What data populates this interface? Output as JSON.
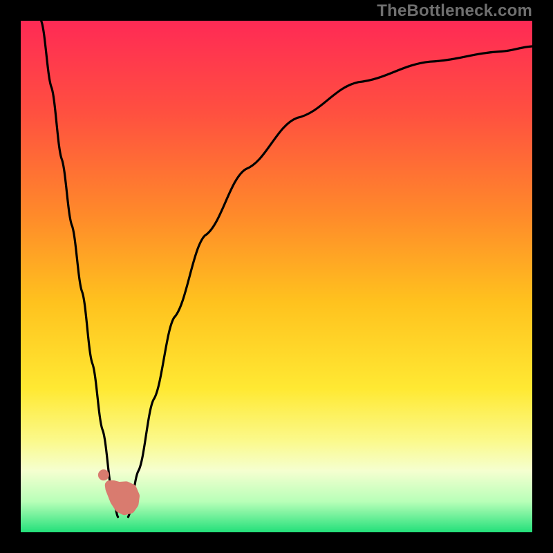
{
  "watermark": {
    "text": "TheBottleneck.com"
  },
  "colors": {
    "background_black": "#000000",
    "gradient_stops": [
      {
        "offset": 0.0,
        "color": "#ff2a55"
      },
      {
        "offset": 0.18,
        "color": "#ff5040"
      },
      {
        "offset": 0.38,
        "color": "#ff8a2a"
      },
      {
        "offset": 0.55,
        "color": "#ffc21e"
      },
      {
        "offset": 0.72,
        "color": "#ffe933"
      },
      {
        "offset": 0.82,
        "color": "#fbf98a"
      },
      {
        "offset": 0.88,
        "color": "#f5ffd0"
      },
      {
        "offset": 0.94,
        "color": "#b8ffb8"
      },
      {
        "offset": 1.0,
        "color": "#23e07a"
      }
    ],
    "curve_color": "#000000",
    "blob_color": "#d97b6f"
  },
  "chart_data": {
    "type": "line",
    "title": "",
    "xlabel": "",
    "ylabel": "",
    "xlim": [
      0,
      100
    ],
    "ylim": [
      0,
      100
    ],
    "series": [
      {
        "name": "left-curve",
        "x": [
          4,
          6,
          8,
          10,
          12,
          14,
          16,
          18,
          19
        ],
        "y": [
          100,
          87,
          73,
          60,
          47,
          33,
          20,
          7,
          3
        ]
      },
      {
        "name": "right-curve",
        "x": [
          21,
          23,
          26,
          30,
          36,
          44,
          54,
          66,
          80,
          94,
          100
        ],
        "y": [
          3,
          12,
          26,
          42,
          58,
          71,
          81,
          88,
          92,
          94,
          95
        ]
      }
    ],
    "blob": {
      "name": "highlight-region",
      "points_xy": [
        [
          17.5,
          8.5
        ],
        [
          18.4,
          6.2
        ],
        [
          19.3,
          4.8
        ],
        [
          20.3,
          4.3
        ],
        [
          21.4,
          4.6
        ],
        [
          22.1,
          5.6
        ],
        [
          22.3,
          7.1
        ],
        [
          21.7,
          8.5
        ],
        [
          20.6,
          9.0
        ],
        [
          19.2,
          8.9
        ],
        [
          18.1,
          9.2
        ],
        [
          17.4,
          9.2
        ]
      ],
      "small_dot_xy": [
        16.2,
        11.2
      ]
    }
  }
}
